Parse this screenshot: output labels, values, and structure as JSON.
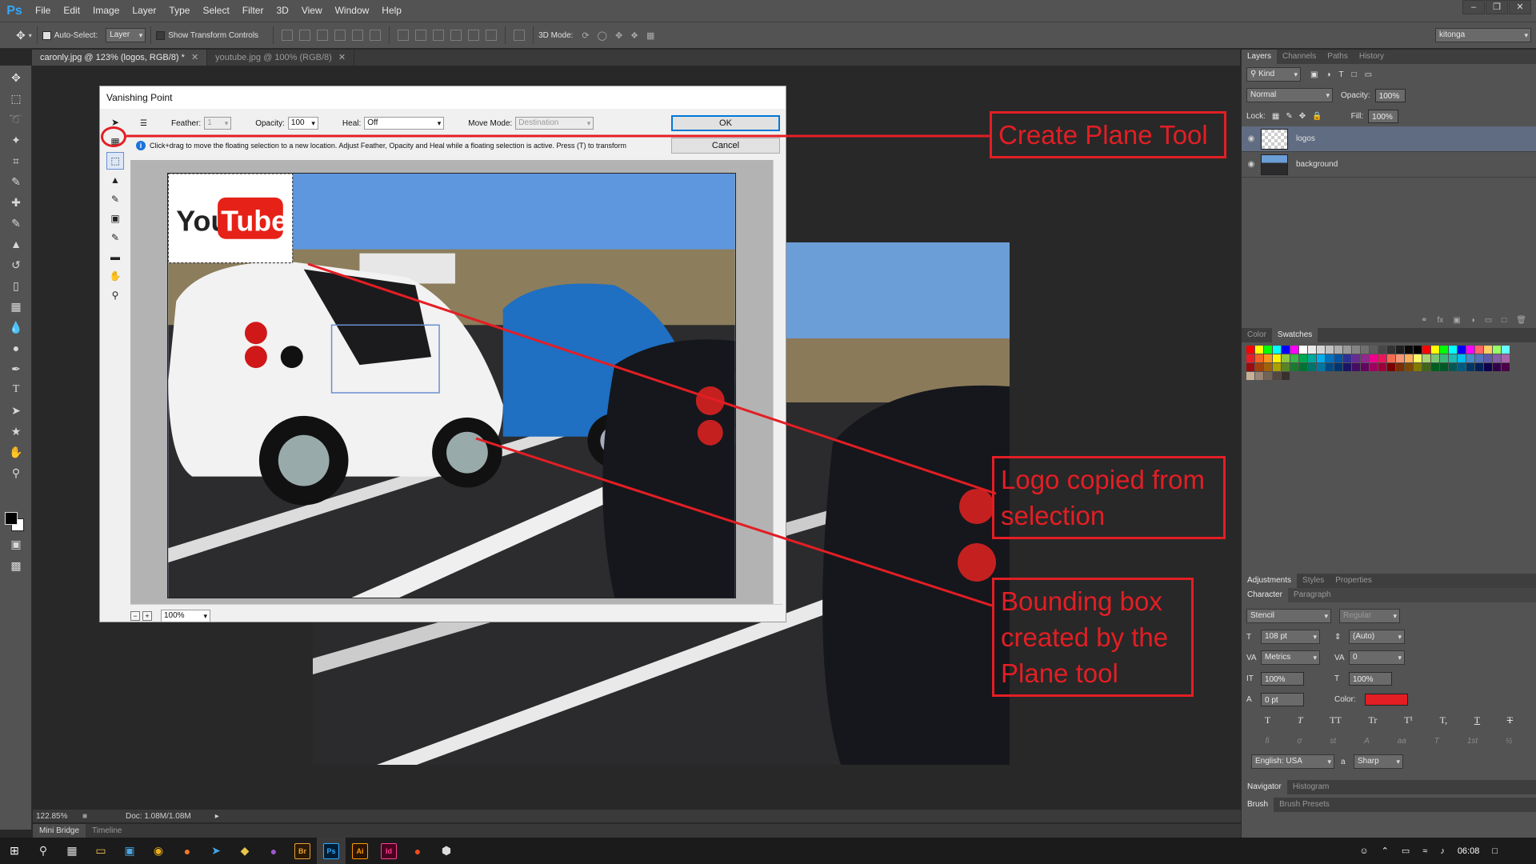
{
  "menubar": {
    "logo": "Ps",
    "items": [
      "File",
      "Edit",
      "Image",
      "Layer",
      "Type",
      "Select",
      "Filter",
      "3D",
      "View",
      "Window",
      "Help"
    ],
    "window_controls": [
      "–",
      "❐",
      "✕"
    ]
  },
  "optionsbar": {
    "auto_select_label": "Auto-Select:",
    "auto_select_value": "Layer",
    "show_transform_label": "Show Transform Controls",
    "mode_3d_label": "3D Mode:",
    "workspace": "kitonga"
  },
  "tabs": [
    {
      "label": "caronly.jpg @ 123% (logos, RGB/8) *",
      "active": true
    },
    {
      "label": "youtube.jpg @ 100% (RGB/8)",
      "active": false
    }
  ],
  "status": {
    "zoom": "122.85%",
    "doc": "Doc: 1.08M/1.08M"
  },
  "bottom_tabs": [
    "Mini Bridge",
    "Timeline"
  ],
  "layers_panel": {
    "tabs": [
      "Layers",
      "Channels",
      "Paths",
      "History"
    ],
    "kind_label": "Kind",
    "blend_mode": "Normal",
    "opacity_label": "Opacity:",
    "opacity_value": "100%",
    "lock_label": "Lock:",
    "fill_label": "Fill:",
    "fill_value": "100%",
    "layers": [
      {
        "name": "logos",
        "selected": true
      },
      {
        "name": "background",
        "selected": false
      }
    ]
  },
  "swatches_panel": {
    "tabs": [
      "Color",
      "Swatches"
    ],
    "colors": [
      "#ff0000",
      "#ffff00",
      "#00ff00",
      "#00ffff",
      "#0000ff",
      "#ff00ff",
      "#ffffff",
      "#ebebeb",
      "#d6d6d6",
      "#c2c2c2",
      "#adadad",
      "#999999",
      "#858585",
      "#707070",
      "#5c5c5c",
      "#474747",
      "#333333",
      "#1f1f1f",
      "#0a0a0a",
      "#000000",
      "#ff0000",
      "#ffff00",
      "#00ff00",
      "#00ffff",
      "#0000ff",
      "#ff00ff",
      "#ff6666",
      "#ffcc66",
      "#99ff66",
      "#66ffff",
      "#ed1c24",
      "#f26522",
      "#f7941d",
      "#fff200",
      "#8dc63f",
      "#39b54a",
      "#00a651",
      "#00a99d",
      "#00aeef",
      "#0072bc",
      "#0054a6",
      "#2e3192",
      "#662d91",
      "#92278f",
      "#ec008c",
      "#ed145b",
      "#f26c4f",
      "#f69679",
      "#fbaf5d",
      "#fff568",
      "#acd373",
      "#7cc576",
      "#3cb878",
      "#1cbbb4",
      "#00bff3",
      "#448ccb",
      "#5574b9",
      "#605ca8",
      "#8560a8",
      "#a864a8",
      "#9e0b0f",
      "#a0410d",
      "#a36209",
      "#aba000",
      "#598527",
      "#1a7b30",
      "#007236",
      "#00746b",
      "#0076a3",
      "#004a80",
      "#003471",
      "#1b1464",
      "#440e62",
      "#630460",
      "#9e005d",
      "#9e0039",
      "#790000",
      "#7b2e00",
      "#7d4900",
      "#827b00",
      "#406618",
      "#005e20",
      "#005826",
      "#005952",
      "#005b7f",
      "#003663",
      "#002157",
      "#0d004c",
      "#32004b",
      "#4b0049",
      "#c7b299",
      "#998675",
      "#736357",
      "#534741",
      "#37302d"
    ]
  },
  "adjust_tabs": [
    "Adjustments",
    "Styles",
    "Properties"
  ],
  "character_panel": {
    "tabs": [
      "Character",
      "Paragraph"
    ],
    "font_family": "Stencil",
    "font_style": "Regular",
    "font_size": "108 pt",
    "leading": "(Auto)",
    "kerning": "Metrics",
    "tracking": "0",
    "vert_scale": "100%",
    "horiz_scale": "100%",
    "baseline": "0 pt",
    "color_label": "Color:",
    "color_value": "#e31e24",
    "style_buttons": [
      "T",
      "T",
      "TT",
      "Tr",
      "T¹",
      "T,",
      "T",
      "T"
    ],
    "ot_buttons": [
      "fi",
      "σ",
      "st",
      "A",
      "aa",
      "T",
      "1st",
      "½"
    ],
    "language": "English: USA",
    "aa_label": "a",
    "antialias": "Sharp"
  },
  "nav_tabs": [
    "Navigator",
    "Histogram"
  ],
  "brush_tabs": [
    "Brush",
    "Brush Presets"
  ],
  "dialog": {
    "title": "Vanishing Point",
    "feather_label": "Feather:",
    "feather_value": "1",
    "opacity_label": "Opacity:",
    "opacity_value": "100",
    "heal_label": "Heal:",
    "heal_value": "Off",
    "move_mode_label": "Move Mode:",
    "move_mode_value": "Destination",
    "ok_label": "OK",
    "cancel_label": "Cancel",
    "info_text": "Click+drag to move the floating selection to a new location. Adjust Feather, Opacity and Heal while a floating selection is active. Press (T) to transform",
    "zoom_value": "100%",
    "logo_text_you": "You",
    "logo_text_tube": "Tube"
  },
  "annotations": [
    {
      "text": "Create Plane Tool"
    },
    {
      "text": "Logo copied from selection"
    },
    {
      "text": "Bounding box created by the Plane tool"
    }
  ],
  "taskbar": {
    "time": "06:08",
    "apps": [
      "Br",
      "Ps",
      "Ai",
      "Id"
    ]
  }
}
